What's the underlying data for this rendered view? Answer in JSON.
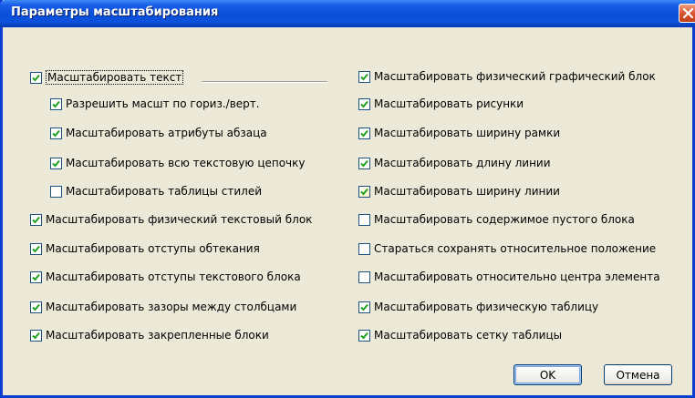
{
  "dialog": {
    "title": "Параметры масштабирования"
  },
  "left_options": [
    {
      "label": "Масштабировать текст",
      "checked": true
    },
    {
      "label": "Разрешить масшт по гориз./верт.",
      "checked": true
    },
    {
      "label": "Масштабировать атрибуты абзаца",
      "checked": true
    },
    {
      "label": "Масштабировать всю текстовую цепочку",
      "checked": true
    },
    {
      "label": "Масштабировать таблицы стилей",
      "checked": false
    },
    {
      "label": "Масштабировать физический текстовый блок",
      "checked": true
    },
    {
      "label": "Масштабировать отступы обтекания",
      "checked": true
    },
    {
      "label": "Масштабировать отступы текстового блока",
      "checked": true
    },
    {
      "label": "Масштабировать зазоры между столбцами",
      "checked": true
    },
    {
      "label": "Масштабировать закрепленные блоки",
      "checked": true
    }
  ],
  "right_options": [
    {
      "label": "Масштабировать физический графический блок",
      "checked": true
    },
    {
      "label": "Масштабировать рисунки",
      "checked": true
    },
    {
      "label": "Масштабировать ширину рамки",
      "checked": true
    },
    {
      "label": "Масштабировать длину линии",
      "checked": true
    },
    {
      "label": "Масштабировать ширину линии",
      "checked": true
    },
    {
      "label": "Масштабировать содержимое пустого блока",
      "checked": false
    },
    {
      "label": "Стараться сохранять относительное положение",
      "checked": false
    },
    {
      "label": "Масштабировать относительно центра элемента",
      "checked": false
    },
    {
      "label": "Масштабировать физическую таблицу",
      "checked": true
    },
    {
      "label": "Масштабировать сетку таблицы",
      "checked": true
    }
  ],
  "buttons": {
    "ok": "OK",
    "cancel": "Отмена"
  },
  "colors": {
    "title_bar": "#0a4fd8",
    "check_mark": "#21a121",
    "dialog_bg": "#ece9d8"
  },
  "icons": {
    "close": "close-icon",
    "check": "check-icon"
  }
}
